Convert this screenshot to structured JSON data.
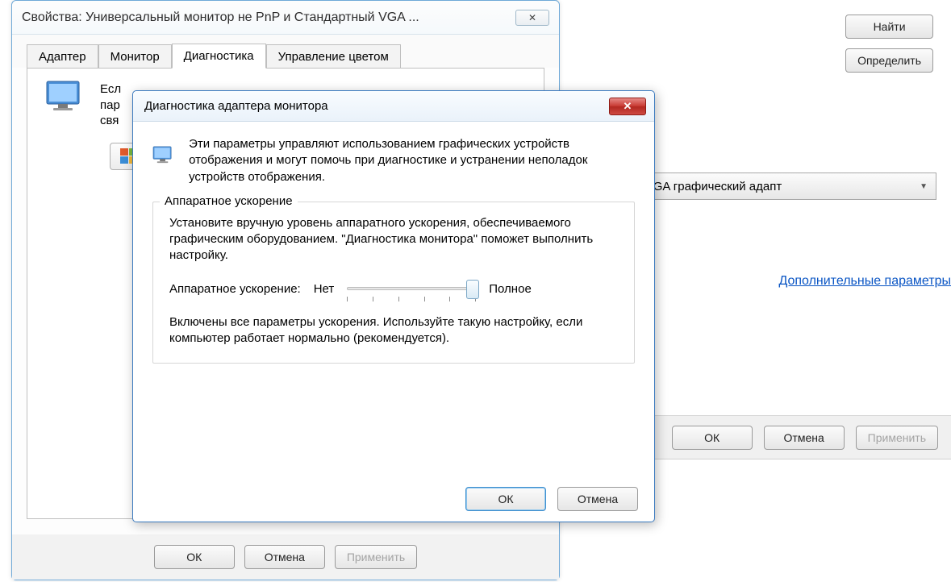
{
  "bg": {
    "find_btn": "Найти",
    "detect_btn": "Определить",
    "dropdown_text": "Стандартный VGA графический адапт",
    "adv_link": "Дополнительные параметры",
    "ok": "ОК",
    "cancel": "Отмена",
    "apply": "Применить"
  },
  "props": {
    "title": "Свойства: Универсальный монитор не PnP и Стандартный VGA ...",
    "tabs": [
      "Адаптер",
      "Монитор",
      "Диагностика",
      "Управление цветом"
    ],
    "active_tab_index": 2,
    "truncated_line1": "Есл",
    "truncated_line2": "пар",
    "truncated_line3": "свя",
    "ok": "ОК",
    "cancel": "Отмена",
    "apply": "Применить"
  },
  "diag": {
    "title": "Диагностика адаптера монитора",
    "intro": "Эти параметры управляют использованием графических устройств отображения и могут помочь при диагностике и устранении неполадок устройств отображения.",
    "group_title": "Аппаратное ускорение",
    "group_text": "Установите вручную уровень аппаратного ускорения, обеспечиваемого графическим оборудованием. \"Диагностика монитора\" поможет выполнить настройку.",
    "slider_label": "Аппаратное ускорение:",
    "slider_min": "Нет",
    "slider_max": "Полное",
    "status_text": "Включены все параметры ускорения. Используйте такую настройку, если компьютер работает нормально (рекомендуется).",
    "ok": "ОК",
    "cancel": "Отмена"
  }
}
